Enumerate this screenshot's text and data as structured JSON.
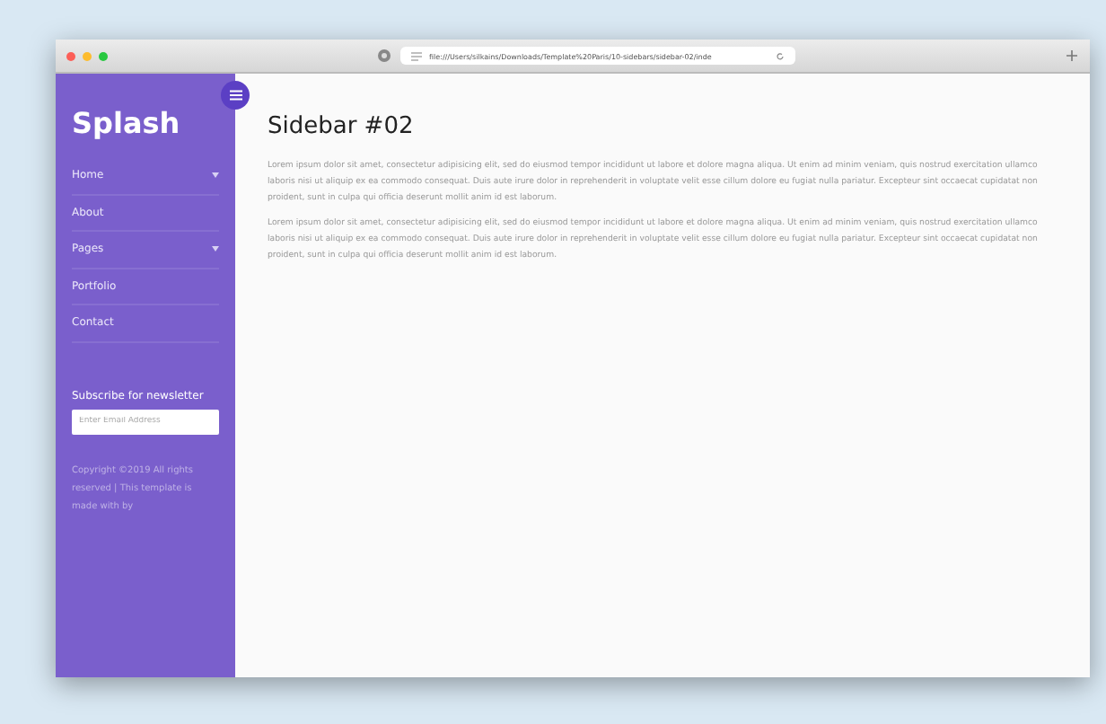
{
  "browser": {
    "address": "file:///Users/silkains/Downloads/Template%20Paris/10-sidebars/sidebar-02/inde"
  },
  "sidebar": {
    "logo": "Splash",
    "menu": [
      {
        "label": "Home",
        "has_submenu": true
      },
      {
        "label": "About",
        "has_submenu": false
      },
      {
        "label": "Pages",
        "has_submenu": true
      },
      {
        "label": "Portfolio",
        "has_submenu": false
      },
      {
        "label": "Contact",
        "has_submenu": false
      }
    ],
    "newsletter": {
      "heading": "Subscribe for newsletter",
      "placeholder": "Enter Email Address"
    },
    "copyright": "Copyright ©2019 All rights reserved | This template is made with by"
  },
  "content": {
    "title": "Sidebar #02",
    "paragraphs": [
      "Lorem ipsum dolor sit amet, consectetur adipisicing elit, sed do eiusmod tempor incididunt ut labore et dolore magna aliqua. Ut enim ad minim veniam, quis nostrud exercitation ullamco laboris nisi ut aliquip ex ea commodo consequat. Duis aute irure dolor in reprehenderit in voluptate velit esse cillum dolore eu fugiat nulla pariatur. Excepteur sint occaecat cupidatat non proident, sunt in culpa qui officia deserunt mollit anim id est laborum.",
      "Lorem ipsum dolor sit amet, consectetur adipisicing elit, sed do eiusmod tempor incididunt ut labore et dolore magna aliqua. Ut enim ad minim veniam, quis nostrud exercitation ullamco laboris nisi ut aliquip ex ea commodo consequat. Duis aute irure dolor in reprehenderit in voluptate velit esse cillum dolore eu fugiat nulla pariatur. Excepteur sint occaecat cupidatat non proident, sunt in culpa qui officia deserunt mollit anim id est laborum."
    ]
  }
}
